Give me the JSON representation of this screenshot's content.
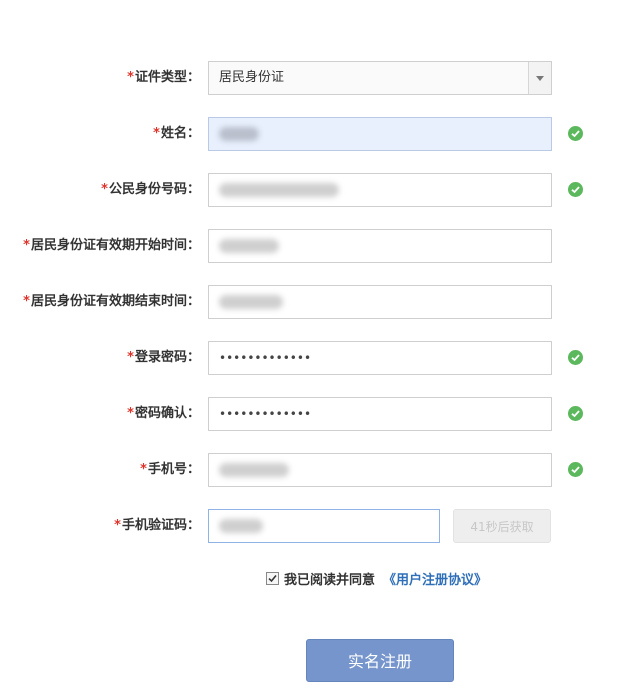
{
  "form": {
    "required_mark": "*",
    "id_type": {
      "label": "证件类型：",
      "value": "居民身份证"
    },
    "name": {
      "label": "姓名："
    },
    "id_number": {
      "label": "公民身份号码："
    },
    "valid_start": {
      "label": "居民身份证有效期开始时间："
    },
    "valid_end": {
      "label": "居民身份证有效期结束时间："
    },
    "password": {
      "label": "登录密码：",
      "value": "•••••••••••••"
    },
    "password_confirm": {
      "label": "密码确认：",
      "value": "•••••••••••••"
    },
    "phone": {
      "label": "手机号："
    },
    "sms_code": {
      "label": "手机验证码：",
      "button_label": "41秒后获取"
    },
    "agreement": {
      "text": "我已阅读并同意",
      "link": "《用户注册协议》",
      "checked": true
    },
    "submit_label": "实名注册"
  },
  "colors": {
    "required": "#e0342b",
    "valid_check": "#5cb85c",
    "link": "#2f6fb8",
    "submit_bg": "#7595cc",
    "focused_field_bg": "#e8f0fe"
  },
  "icons": {
    "valid": "check-circle-icon",
    "dropdown": "chevron-down-icon",
    "checkbox": "checkmark-icon"
  }
}
